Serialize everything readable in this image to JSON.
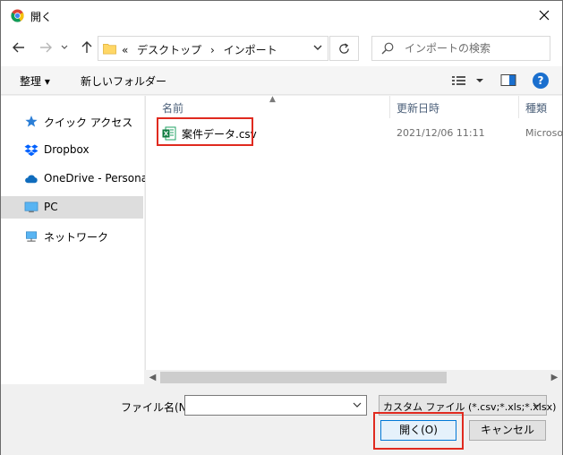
{
  "window": {
    "title": "開く",
    "icons": {
      "app": "chrome-icon",
      "close": "close-icon"
    }
  },
  "nav": {
    "back_icon": "arrow-left-icon",
    "forward_icon": "arrow-right-icon",
    "recent_icon": "chevron-down-icon",
    "up_icon": "arrow-up-icon",
    "breadcrumb": [
      "«",
      "デスクトップ",
      "›",
      "インポート"
    ],
    "refresh_icon": "refresh-icon",
    "search_placeholder": "インポートの検索"
  },
  "toolbar": {
    "organize_label": "整理 ▾",
    "new_folder_label": "新しいフォルダー"
  },
  "sidebar": {
    "items": [
      {
        "label": "クイック アクセス",
        "icon": "star-icon"
      },
      {
        "label": "Dropbox",
        "icon": "dropbox-icon"
      },
      {
        "label": "OneDrive - Personal",
        "icon": "cloud-icon"
      },
      {
        "label": "PC",
        "icon": "pc-icon",
        "selected": true
      },
      {
        "label": "ネットワーク",
        "icon": "network-icon"
      }
    ]
  },
  "columns": {
    "name": "名前",
    "modified": "更新日時",
    "type": "種類"
  },
  "files": [
    {
      "name": "案件データ.csv",
      "modified": "2021/12/06 11:11",
      "type": "Microso",
      "icon": "excel-csv-icon"
    }
  ],
  "bottom": {
    "filename_label": "ファイル名(N):",
    "filename_value": "",
    "filter_value": "カスタム ファイル (*.csv;*.xls;*.xlsx)",
    "open_label": "開く(O)",
    "cancel_label": "キャンセル"
  },
  "colors": {
    "accent": "#0078d7",
    "highlight": "#e02a1f",
    "selected_bg": "#dddddd"
  }
}
